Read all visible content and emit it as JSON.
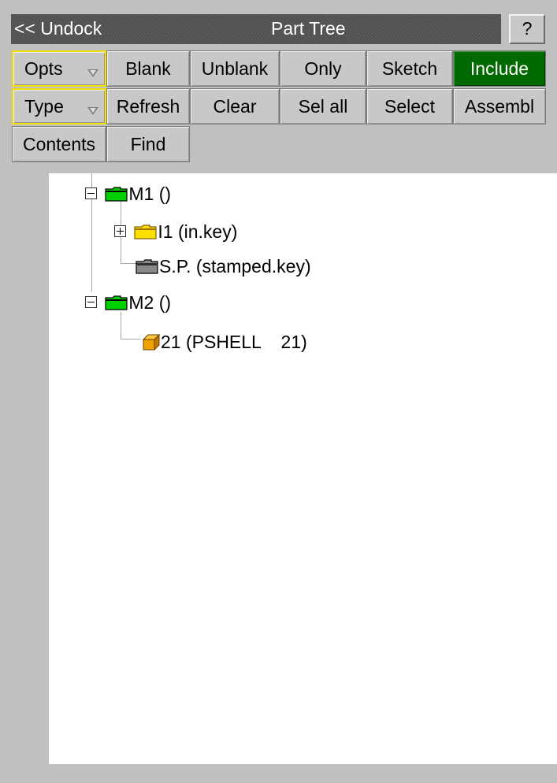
{
  "window": {
    "undock_label": "<< Undock",
    "title": "Part Tree",
    "help_label": "?"
  },
  "toolbar": {
    "row1": {
      "opts": "Opts",
      "blank": "Blank",
      "unblank": "Unblank",
      "only": "Only",
      "sketch": "Sketch",
      "include": "Include"
    },
    "row2": {
      "type": "Type",
      "refresh": "Refresh",
      "clear": "Clear",
      "sel_all": "Sel all",
      "select": "Select",
      "assembl": "Assembl"
    },
    "row3": {
      "contents": "Contents",
      "find": "Find"
    }
  },
  "tree": {
    "nodes": [
      {
        "label": "M1 ()",
        "icon": "green-folder-icon",
        "expander": "minus"
      },
      {
        "label": "I1 (in.key)",
        "icon": "yellow-folder-icon",
        "expander": "plus"
      },
      {
        "label": "S.P. (stamped.key)",
        "icon": "grey-folder-icon",
        "expander": "none"
      },
      {
        "label": "M2 ()",
        "icon": "green-folder-icon",
        "expander": "minus"
      },
      {
        "label": "21 (PSHELL    21)",
        "icon": "orange-part-cube-icon",
        "expander": "none"
      }
    ]
  },
  "colors": {
    "include_active": "#006a00",
    "dropdown_highlight": "#f0e000",
    "folder_green": "#00d000",
    "folder_yellow": "#ffe000",
    "folder_grey": "#707070",
    "part_orange": "#f0a000",
    "title_bar": "#545454"
  }
}
